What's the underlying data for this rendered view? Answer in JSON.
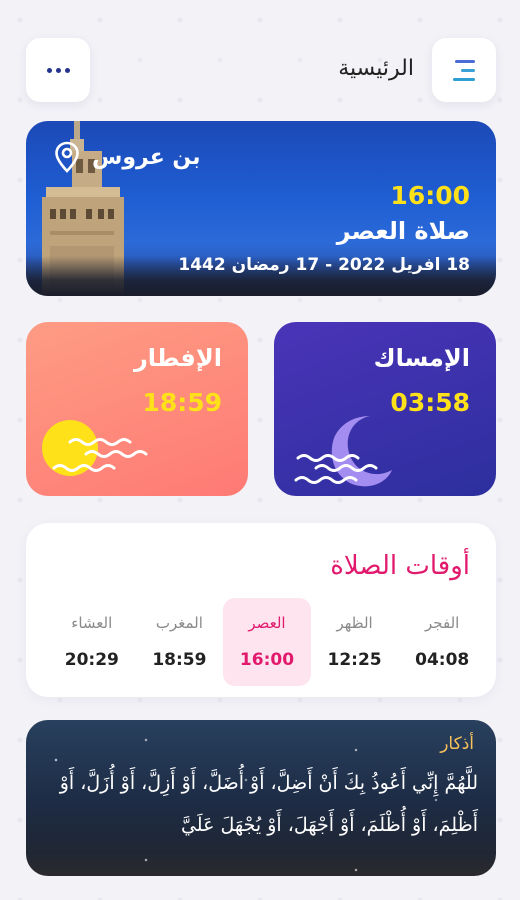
{
  "header": {
    "title": "الرئيسية",
    "more_icon": "more-dots-icon",
    "menu_icon": "menu-icon"
  },
  "hero": {
    "location": "بن عروس",
    "next_prayer_time": "16:00",
    "next_prayer_name": "صلاة العصر",
    "date": "18 افريل 2022 - 17 رمضان 1442"
  },
  "imsak": {
    "label": "الإمساك",
    "time": "03:58"
  },
  "iftar": {
    "label": "الإفطار",
    "time": "18:59"
  },
  "prayer_times": {
    "title": "أوقات الصلاة",
    "items": [
      {
        "name": "الفجر",
        "time": "04:08"
      },
      {
        "name": "الظهر",
        "time": "12:25"
      },
      {
        "name": "العصر",
        "time": "16:00",
        "active": true
      },
      {
        "name": "المغرب",
        "time": "18:59"
      },
      {
        "name": "العشاء",
        "time": "20:29"
      }
    ]
  },
  "dhikr": {
    "title": "أذكار",
    "text": "للَّهُمَّ إِنِّي أَعُوذُ بِكَ أَنْ أَضِلَّ، أَوْ أُضَلَّ، أَوْ أَزِلَّ، أَوْ أُزَلَّ، أَوْ أَظْلِمَ، أَوْ أُظْلَمَ، أَوْ أَجْهَلَ، أَوْ يُجْهَلَ عَلَيَّ"
  },
  "colors": {
    "accent_pink": "#e21a6e",
    "time_yellow": "#ffe11a",
    "hero_blue": "#1f5ed4",
    "imsak_purple": "#3b31ac",
    "iftar_coral": "#fe8a7c"
  }
}
